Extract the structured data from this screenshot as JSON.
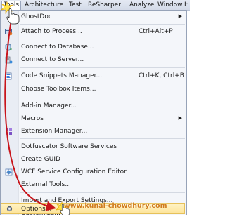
{
  "menubar": {
    "items": [
      "Tools",
      "Architecture",
      "Test",
      "ReSharper",
      "Analyze",
      "Window",
      "H"
    ]
  },
  "menu": {
    "items": [
      {
        "label": "GhostDoc",
        "submenu": true,
        "icon": "ghostdoc-icon"
      },
      {
        "label": "Attach to Process...",
        "shortcut": "Ctrl+Alt+P",
        "icon": "attach-process-icon"
      },
      {
        "label": "Connect to Database...",
        "icon": "database-icon"
      },
      {
        "label": "Connect to Server...",
        "icon": "server-icon"
      },
      {
        "label": "Code Snippets Manager...",
        "shortcut": "Ctrl+K, Ctrl+B",
        "icon": "snippets-icon"
      },
      {
        "label": "Choose Toolbox Items..."
      },
      {
        "label": "Add-in Manager..."
      },
      {
        "label": "Macros",
        "submenu": true
      },
      {
        "label": "Extension Manager...",
        "icon": "extension-icon"
      },
      {
        "label": "Dotfuscator Software Services"
      },
      {
        "label": "Create GUID"
      },
      {
        "label": "WCF Service Configuration Editor",
        "icon": "wcf-icon"
      },
      {
        "label": "External Tools..."
      },
      {
        "label": "Import and Export Settings..."
      },
      {
        "label": "Customize..."
      },
      {
        "label": "Options...",
        "icon": "options-gear-icon",
        "highlighted": true
      }
    ]
  },
  "watermark": "www.kunal-chowdhury.com",
  "colors": {
    "menubar": "#d9dfea",
    "menu_background": "#f4f6fa",
    "highlight": "#fde49a",
    "annotation_arrow": "#c8151b",
    "watermark": "#d07c1c"
  }
}
